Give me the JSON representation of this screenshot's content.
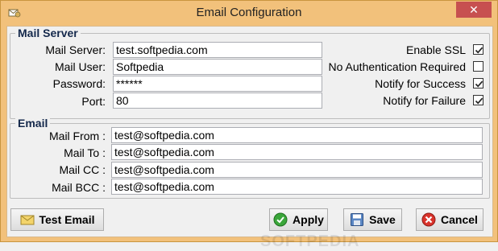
{
  "window": {
    "title": "Email Configuration",
    "close_glyph": "✕"
  },
  "mail_server": {
    "group_title": "Mail Server",
    "fields": [
      {
        "label": "Mail Server:",
        "value": "test.softpedia.com"
      },
      {
        "label": "Mail User:",
        "value": "Softpedia"
      },
      {
        "label": "Password:",
        "value": "******"
      },
      {
        "label": "Port:",
        "value": "80"
      }
    ],
    "options": [
      {
        "label": "Enable SSL",
        "checked": true
      },
      {
        "label": "No Authentication Required",
        "checked": false
      },
      {
        "label": "Notify for Success",
        "checked": true
      },
      {
        "label": "Notify for Failure",
        "checked": true
      }
    ]
  },
  "email": {
    "group_title": "Email",
    "fields": [
      {
        "label": "Mail From :",
        "value": "test@softpedia.com"
      },
      {
        "label": "Mail To :",
        "value": "test@softpedia.com"
      },
      {
        "label": "Mail CC :",
        "value": "test@softpedia.com"
      },
      {
        "label": "Mail BCC :",
        "value": "test@softpedia.com"
      }
    ]
  },
  "buttons": {
    "test_email": "Test Email",
    "apply": "Apply",
    "save": "Save",
    "cancel": "Cancel"
  },
  "watermark": "SOFTPEDIA",
  "colors": {
    "title_bar": "#f2c17b",
    "close_button": "#c75050",
    "group_title": "#14284b"
  }
}
